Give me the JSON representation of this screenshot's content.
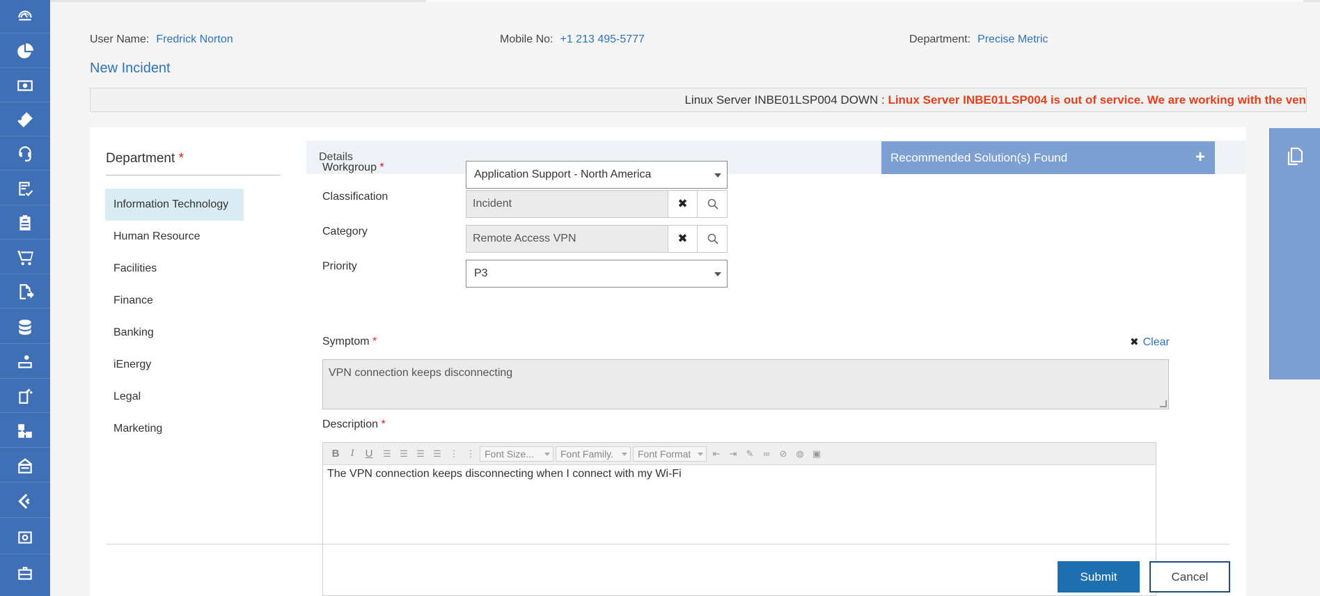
{
  "rail": {
    "icons": [
      "dashboard-icon",
      "pie-chart-icon",
      "money-icon",
      "ticket-icon",
      "support-agent-icon",
      "checklist-icon",
      "clipboard-icon",
      "cart-icon",
      "document-export-icon",
      "database-icon",
      "service-desk-icon",
      "request-icon",
      "network-icon",
      "inbox-icon",
      "change-icon",
      "settings-gear-icon",
      "briefcase-icon"
    ]
  },
  "header": {
    "user_name_label": "User Name:",
    "user_name": "Fredrick Norton",
    "mobile_label": "Mobile No:",
    "mobile": "+1 213 495-5777",
    "department_label": "Department:",
    "department": "Precise Metric",
    "page_title": "New Incident"
  },
  "ticker": {
    "title": "Linux Server INBE01LSP004 DOWN :",
    "message": "Linux Server INBE01LSP004 is out of service. We are working with the ven"
  },
  "department_panel": {
    "title": "Department",
    "required_mark": "*",
    "items": [
      "Information Technology",
      "Human Resource",
      "Facilities",
      "Finance",
      "Banking",
      "iEnergy",
      "Legal",
      "Marketing"
    ],
    "selected": "Information Technology"
  },
  "details": {
    "tab_label": "Details",
    "recommended_label": "Recommended Solution(s) Found",
    "recommended_icon": "+"
  },
  "form": {
    "workgroup_label": "Workgroup",
    "workgroup_value": "Application Support - North America",
    "classification_label": "Classification",
    "classification_value": "Incident",
    "category_label": "Category",
    "category_value": "Remote Access VPN",
    "priority_label": "Priority",
    "priority_value": "P3",
    "symptom_label": "Symptom",
    "clear_label": "Clear",
    "symptom_value": "VPN connection keeps disconnecting",
    "description_label": "Description",
    "description_value": "The VPN connection keeps disconnecting when I connect with my Wi-Fi",
    "required_mark": "*"
  },
  "editor_toolbar": {
    "bold": "B",
    "italic": "I",
    "underline": "U",
    "font_size": "Font Size...",
    "font_family": "Font Family.",
    "font_format": "Font Format"
  },
  "actions": {
    "submit": "Submit",
    "cancel": "Cancel"
  },
  "colors": {
    "rail": "#3f6fb4",
    "accent": "#2f72b8",
    "ticker_alert": "#e8401c",
    "recommended_bar": "#7d9fd2",
    "submit": "#1e6fb0"
  }
}
